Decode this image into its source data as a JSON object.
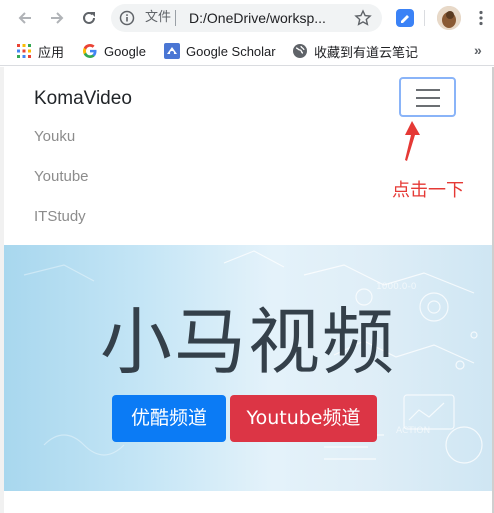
{
  "browser": {
    "omnibox": {
      "scheme_label": "文件",
      "url": "D:/OneDrive/worksp..."
    },
    "bookmarks": [
      {
        "label": "应用",
        "icon": "apps-grid-icon"
      },
      {
        "label": "Google",
        "icon": "google-icon"
      },
      {
        "label": "Google Scholar",
        "icon": "scholar-icon"
      },
      {
        "label": "收藏到有道云笔记",
        "icon": "globe-icon"
      }
    ],
    "bookmarks_more": "»"
  },
  "page": {
    "navbar": {
      "brand": "KomaVideo",
      "links": [
        "Youku",
        "Youtube",
        "ITStudy"
      ]
    },
    "annotation": {
      "text": "点击一下",
      "color": "#e53935"
    },
    "hero": {
      "title": "小马视频",
      "buttons": [
        {
          "label": "优酷频道",
          "style": "primary",
          "color": "#0b7bf5"
        },
        {
          "label": "Youtube频道",
          "style": "danger",
          "color": "#dc3545"
        }
      ]
    }
  }
}
